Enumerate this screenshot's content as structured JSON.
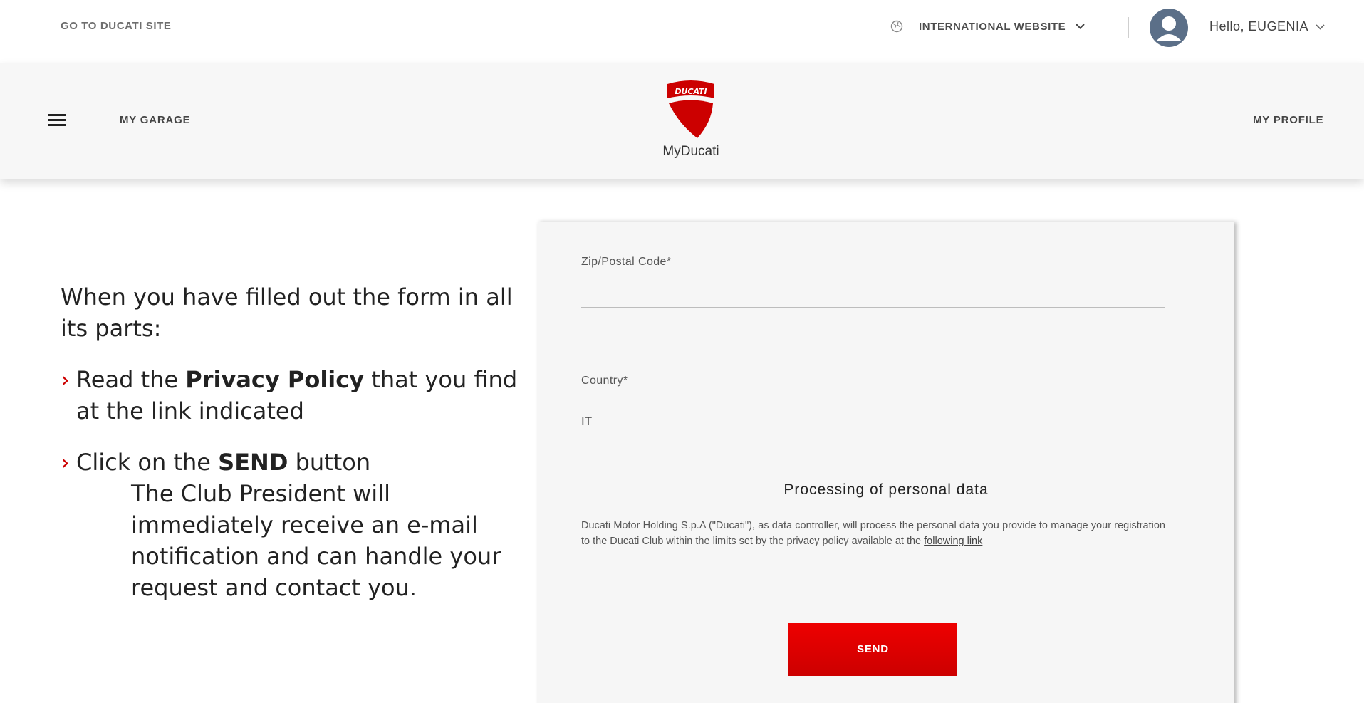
{
  "topbar": {
    "goto_label": "GO TO DUCATI SITE",
    "website_label": "INTERNATIONAL WEBSITE",
    "greeting": "Hello, EUGENIA"
  },
  "nav": {
    "garage_label": "MY GARAGE",
    "profile_label": "MY PROFILE",
    "brand_name": "MyDucati",
    "logo_text": "DUCATI"
  },
  "instructions": {
    "intro": "When you have filled out the form in all its parts:",
    "bullet": "›",
    "step1_pre": "Read the ",
    "step1_bold": "Privacy Policy",
    "step1_post": " that you find at the link indicated",
    "step2_pre": "Click on the ",
    "step2_bold": "SEND",
    "step2_post": " button",
    "step2_detail": "The Club President will immediately receive an e-mail notification and can handle your request and contact you."
  },
  "form": {
    "zip_label": "Zip/Postal Code*",
    "zip_value": "",
    "country_label": "Country*",
    "country_value": "IT",
    "privacy_title": "Processing of personal data",
    "privacy_text": "Ducati Motor Holding S.p.A (\"Ducati\"), as data controller, will process the personal data you provide to manage your registration to the Ducati Club within the limits set by the privacy policy available at the ",
    "privacy_link": "following link",
    "send_label": "SEND"
  },
  "colors": {
    "brand_red": "#cc0000",
    "avatar": "#5b6f88"
  }
}
